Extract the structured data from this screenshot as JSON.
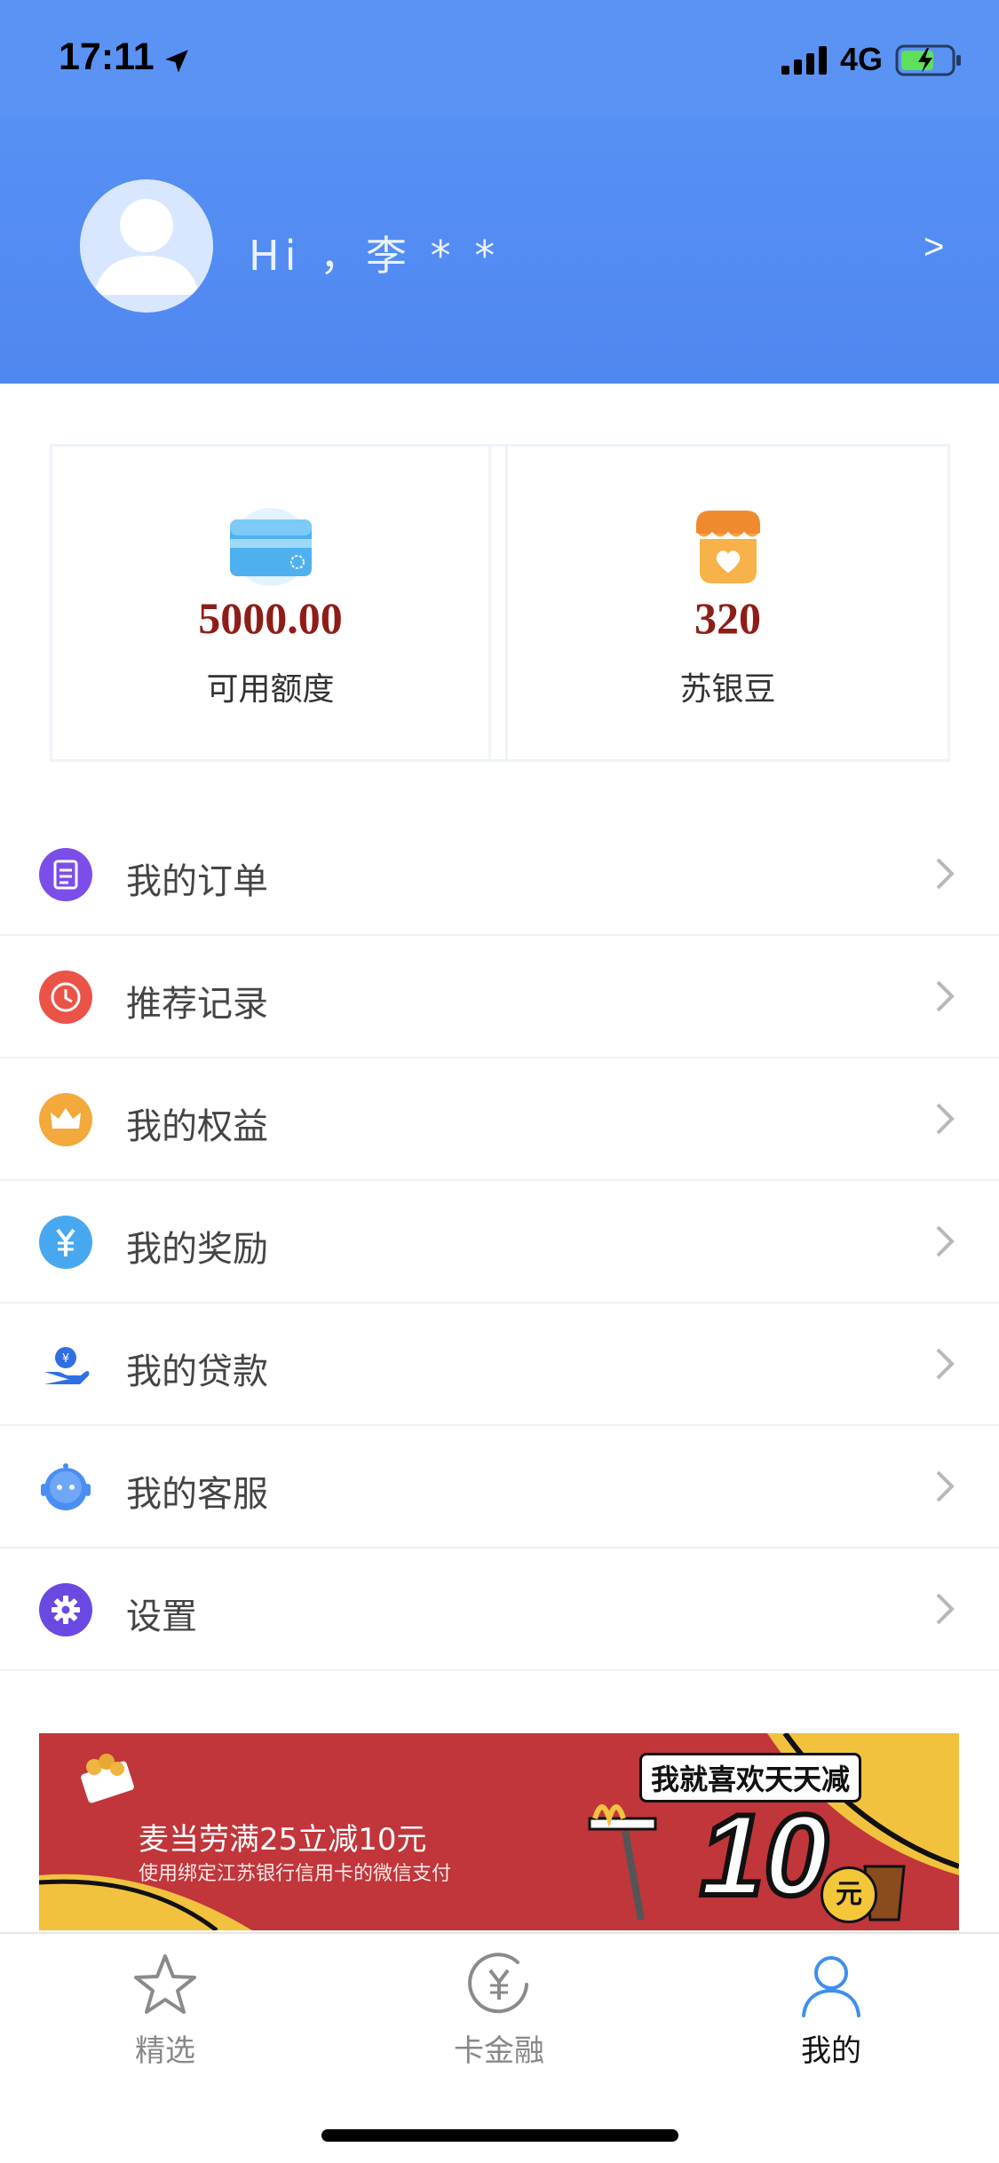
{
  "status_bar": {
    "time": "17:11",
    "network": "4G",
    "location_icon": "location-arrow-icon",
    "signal_icon": "signal-bars-icon",
    "battery_icon": "battery-charging-icon"
  },
  "profile": {
    "greeting": "Hi ，李 * *",
    "arrow": ">",
    "avatar_icon": "user-avatar-icon"
  },
  "cards": [
    {
      "value": "5000.00",
      "label": "可用额度",
      "icon": "credit-card-icon"
    },
    {
      "value": "320",
      "label": "苏银豆",
      "icon": "shop-heart-icon"
    }
  ],
  "menu": [
    {
      "label": "我的订单",
      "icon": "order-list-icon",
      "color": "#7b4de9"
    },
    {
      "label": "推荐记录",
      "icon": "clock-icon",
      "color": "#ea5346"
    },
    {
      "label": "我的权益",
      "icon": "crown-icon",
      "color": "#f3a93b"
    },
    {
      "label": "我的奖励",
      "icon": "yuan-coin-icon",
      "color": "#47a8f0"
    },
    {
      "label": "我的贷款",
      "icon": "loan-hand-icon",
      "color": "#2f6fe4"
    },
    {
      "label": "我的客服",
      "icon": "robot-service-icon",
      "color": "#4a8ef5"
    },
    {
      "label": "设置",
      "icon": "settings-gear-icon",
      "color": "#6a49e3"
    }
  ],
  "banner": {
    "title": "麦当劳满25立减10元",
    "subtitle": "使用绑定江苏银行信用卡的微信支付",
    "slogan": "我就喜欢天天减",
    "amount": "10",
    "unit": "元",
    "bg_color": "#c0363a"
  },
  "tabbar": [
    {
      "label": "精选",
      "icon": "star-icon",
      "active": false
    },
    {
      "label": "卡金融",
      "icon": "yuan-circle-icon",
      "active": false
    },
    {
      "label": "我的",
      "icon": "person-icon",
      "active": true
    }
  ],
  "colors": {
    "header_blue": "#4f87f0",
    "value_red": "#8f1d17",
    "active_tab": "#3e8ef0"
  }
}
